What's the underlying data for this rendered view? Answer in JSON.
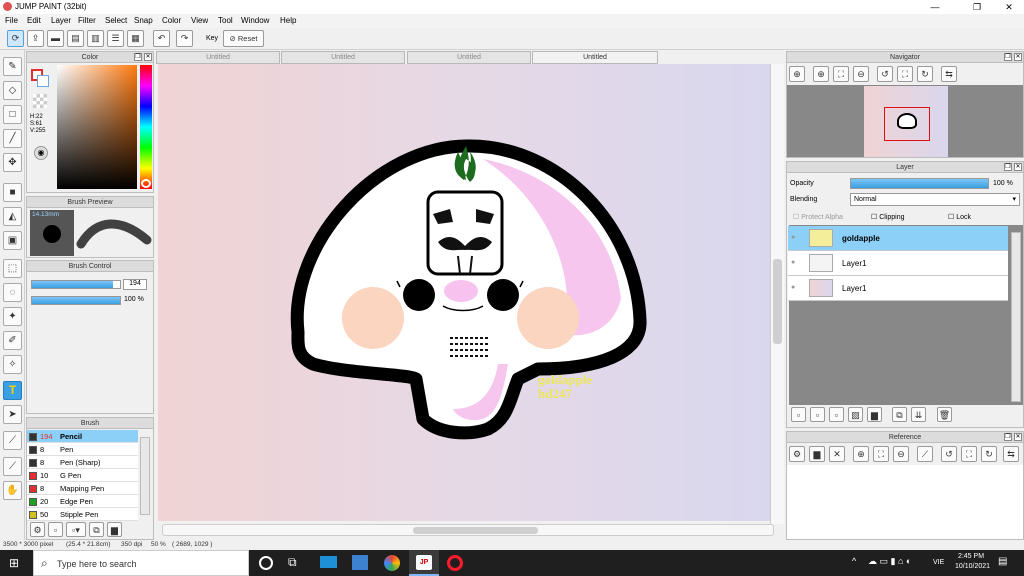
{
  "app": {
    "title": "JUMP PAINT (32bit)"
  },
  "menu": [
    "File",
    "Edit",
    "Layer",
    "Filter",
    "Select",
    "Snap",
    "Color",
    "View",
    "Tool",
    "Window",
    "Help"
  ],
  "toolbar": {
    "key_label": "Key",
    "reset_label": "Reset"
  },
  "doc_tabs": [
    "Untitled",
    "Untitled",
    "Untitled",
    "Untitled"
  ],
  "color_panel": {
    "title": "Color",
    "h": "H:22",
    "s": "S:61",
    "v": "V:255"
  },
  "brush_preview": {
    "title": "Brush Preview",
    "size": "14.13mm"
  },
  "brush_control": {
    "title": "Brush Control",
    "size_value": "194",
    "opacity_value": "100 %",
    "size_fill": 0.92,
    "opacity_fill": 1.0
  },
  "brush_panel": {
    "title": "Brush",
    "items": [
      {
        "size": "194",
        "name": "Pencil",
        "color": "#333333"
      },
      {
        "size": "8",
        "name": "Pen",
        "color": "#333333"
      },
      {
        "size": "8",
        "name": "Pen (Sharp)",
        "color": "#333333"
      },
      {
        "size": "10",
        "name": "G Pen",
        "color": "#e03030"
      },
      {
        "size": "8",
        "name": "Mapping Pen",
        "color": "#e03030"
      },
      {
        "size": "20",
        "name": "Edge Pen",
        "color": "#20a020"
      },
      {
        "size": "50",
        "name": "Stipple Pen",
        "color": "#d0c020"
      }
    ]
  },
  "navigator": {
    "title": "Navigator"
  },
  "layer_panel": {
    "title": "Layer",
    "opacity_label": "Opacity",
    "opacity_value": "100 %",
    "opacity_fill": 1.0,
    "blending_label": "Blending",
    "blending_value": "Normal",
    "protect_alpha": "Protect Alpha",
    "clipping": "Clipping",
    "lock": "Lock",
    "layers": [
      {
        "name": "goldapple",
        "selected": true
      },
      {
        "name": "Layer1",
        "selected": false
      },
      {
        "name": "Layer1",
        "selected": false
      }
    ]
  },
  "reference": {
    "title": "Reference"
  },
  "artwork": {
    "watermark_line1": "goldapple",
    "watermark_line2": "hd247"
  },
  "status": {
    "dimensions": "3500 * 3000 pixel",
    "size_cm": "(25.4 * 21.8cm)",
    "dpi": "350 dpi",
    "zoom": "50 %",
    "coords": "( 2689, 1029 )"
  },
  "taskbar": {
    "search_placeholder": "Type here to search",
    "language": "VIE",
    "time": "2:45 PM",
    "date": "10/10/2021"
  },
  "colors": {
    "accent": "#3aa0e6",
    "selected_row": "#8ccff7",
    "taskbar": "#1f1f1f",
    "watermark": "#ece65a"
  }
}
